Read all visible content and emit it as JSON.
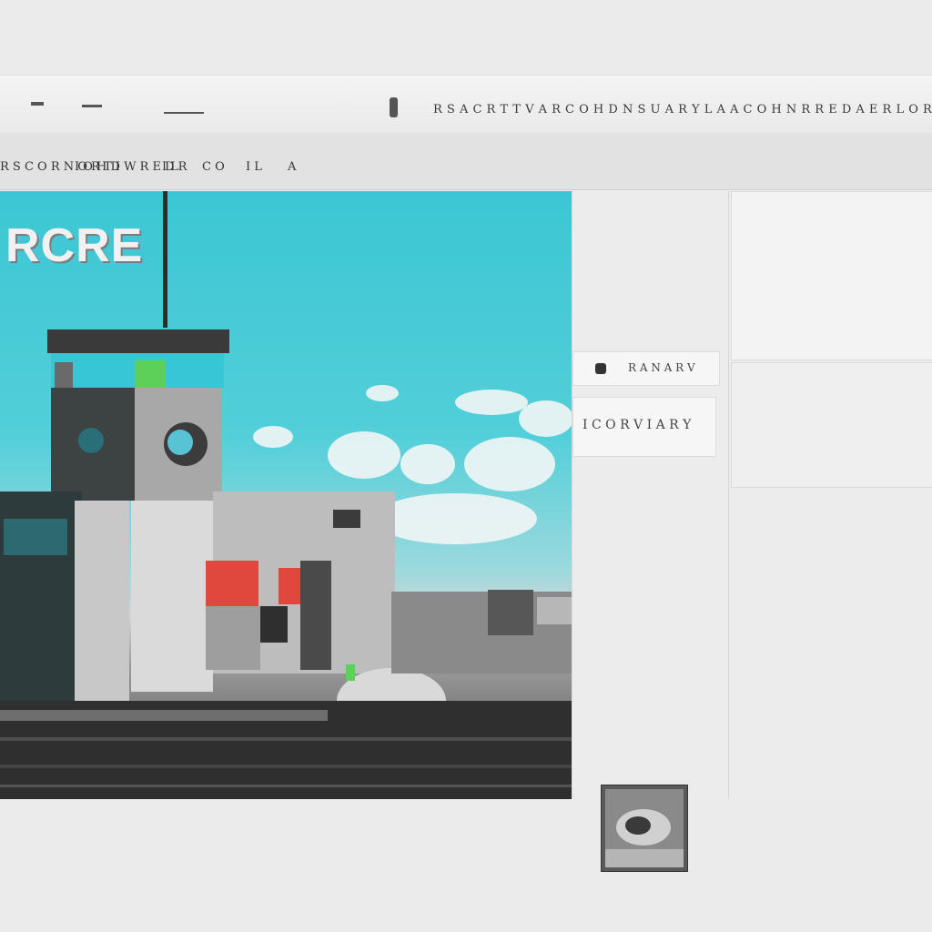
{
  "window": {
    "title": "R S A C R T T V A R C O H D N S U A R Y L A A C O H N R R E D A E R L O R E"
  },
  "toolbar": {
    "items": [
      {
        "label": "R S C O R N O R T I"
      },
      {
        "label": "I O H D W R E D R"
      },
      {
        "label": "I L"
      },
      {
        "label": "C O"
      },
      {
        "label": "I L"
      },
      {
        "label": "A"
      }
    ]
  },
  "canvas": {
    "headline": "RCRE"
  },
  "inspector": {
    "row1_label": "R A N A R V",
    "row2_label": "I C O R V I A R Y"
  },
  "colors": {
    "sky": "#3cc6d4",
    "accent_red": "#e0483b",
    "accent_green": "#5dd05a"
  }
}
